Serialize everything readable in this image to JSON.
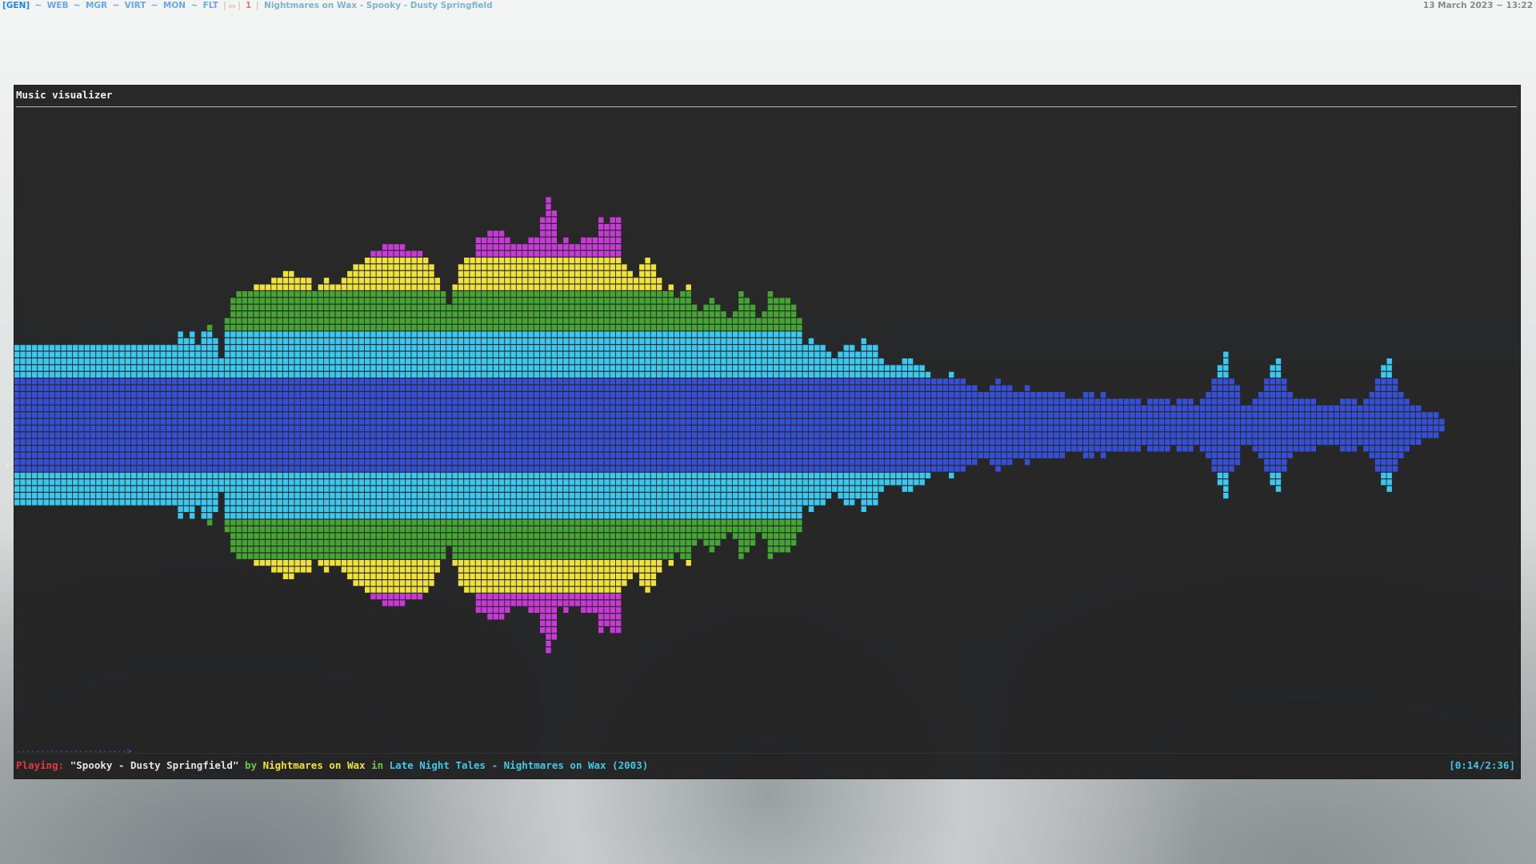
{
  "topbar": {
    "workspaces": [
      {
        "label": "[GEN]",
        "active": true
      },
      {
        "label": "WEB",
        "active": false
      },
      {
        "label": "MGR",
        "active": false
      },
      {
        "label": "VIRT",
        "active": false
      },
      {
        "label": "MON",
        "active": false
      },
      {
        "label": "FLT",
        "active": false
      }
    ],
    "separator": "~",
    "window_count": "1",
    "window_title": "Nightmares on Wax - Spooky - Dusty Springfield",
    "datetime": "13 March 2023 ~ 13:22"
  },
  "window": {
    "title": "Music visualizer",
    "progress_bar": "----------------------->",
    "status": {
      "playing_label": "Playing:",
      "song": "\"Spooky - Dusty Springfield\"",
      "by_word": "by",
      "artist": "Nightmares on Wax",
      "in_word": "in",
      "album": "Late Night Tales - Nightmares on Wax (2003)",
      "time": "[0:14/2:36]"
    }
  },
  "visualizer": {
    "amplitude_levels": [
      12,
      12,
      12,
      12,
      12,
      12,
      12,
      12,
      12,
      12,
      12,
      12,
      12,
      12,
      12,
      12,
      12,
      12,
      12,
      12,
      12,
      12,
      12,
      12,
      12,
      12,
      12,
      12,
      14,
      13,
      14,
      12,
      14,
      15,
      13,
      10,
      16,
      19,
      20,
      20,
      20,
      21,
      21,
      21,
      22,
      22,
      23,
      23,
      22,
      22,
      22,
      20,
      21,
      22,
      21,
      21,
      22,
      23,
      24,
      24,
      25,
      26,
      26,
      27,
      27,
      27,
      27,
      26,
      26,
      26,
      25,
      24,
      22,
      20,
      18,
      21,
      24,
      25,
      25,
      28,
      28,
      29,
      29,
      29,
      28,
      27,
      27,
      27,
      28,
      28,
      31,
      34,
      32,
      27,
      28,
      27,
      27,
      28,
      28,
      28,
      31,
      30,
      31,
      31,
      24,
      23,
      22,
      24,
      25,
      24,
      22,
      20,
      21,
      19,
      20,
      21,
      18,
      17,
      18,
      19,
      18,
      17,
      16,
      17,
      20,
      19,
      18,
      16,
      17,
      20,
      19,
      19,
      19,
      18,
      16,
      12,
      13,
      12,
      12,
      11,
      10,
      11,
      12,
      12,
      11,
      13,
      12,
      12,
      10,
      9,
      9,
      9,
      10,
      10,
      9,
      9,
      8,
      7,
      7,
      7,
      8,
      7,
      7,
      6,
      6,
      5,
      5,
      6,
      7,
      6,
      6,
      5,
      5,
      6,
      5,
      5,
      5,
      5,
      5,
      5,
      4,
      4,
      4,
      5,
      5,
      4,
      5,
      4,
      4,
      4,
      4,
      4,
      4,
      3,
      4,
      4,
      4,
      4,
      3,
      4,
      4,
      4,
      3,
      4,
      5,
      7,
      9,
      11,
      7,
      6,
      3,
      3,
      4,
      5,
      7,
      9,
      10,
      7,
      5,
      4,
      4,
      4,
      4,
      3,
      3,
      3,
      3,
      4,
      4,
      4,
      3,
      4,
      5,
      7,
      9,
      10,
      7,
      5,
      4,
      3,
      3,
      2,
      2,
      2,
      1
    ],
    "max_level": 34,
    "colors": {
      "low": "#3550d6",
      "mid": "#3ac8f0",
      "high": "#45a532",
      "peak": "#f0e23a",
      "top": "#c83ad6"
    }
  }
}
